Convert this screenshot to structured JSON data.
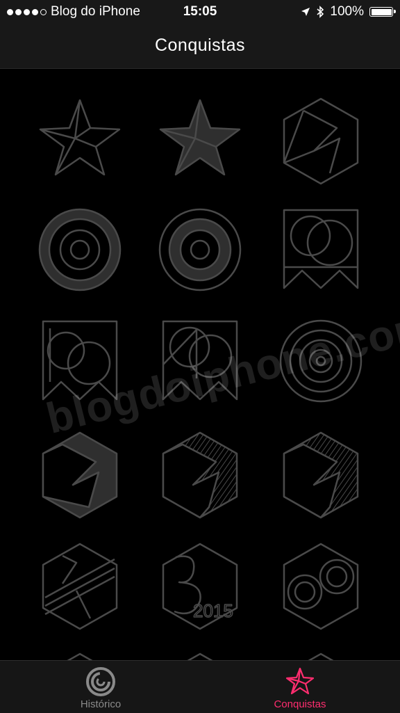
{
  "status_bar": {
    "carrier": "Blog do iPhone",
    "time": "15:05",
    "battery": "100%",
    "signal_bars": 4,
    "signal_max": 5
  },
  "nav": {
    "title": "Conquistas"
  },
  "watermark": "blogdoiphone.com",
  "badges": [
    {
      "name": "star-outline-badge"
    },
    {
      "name": "star-filled-badge"
    },
    {
      "name": "hexagon-outline-badge"
    },
    {
      "name": "target-badge-1"
    },
    {
      "name": "target-badge-2"
    },
    {
      "name": "rings-banner-badge-1"
    },
    {
      "name": "rings-banner-badge-2"
    },
    {
      "name": "rings-banner-badge-3"
    },
    {
      "name": "target-outline-badge"
    },
    {
      "name": "hexagon-gray-badge"
    },
    {
      "name": "hexagon-striped-badge-1"
    },
    {
      "name": "hexagon-striped-badge-2"
    },
    {
      "name": "hexagon-stripes-badge"
    },
    {
      "name": "hexagon-2015-badge"
    },
    {
      "name": "hexagon-infinity-badge"
    }
  ],
  "tabs": [
    {
      "label": "Histórico",
      "icon": "activity-rings-icon",
      "active": false
    },
    {
      "label": "Conquistas",
      "icon": "star-icon",
      "active": true
    }
  ],
  "colors": {
    "accent": "#ff2d6f",
    "badge_stroke": "#4a4a4a",
    "badge_fill": "#2f2f2f"
  }
}
